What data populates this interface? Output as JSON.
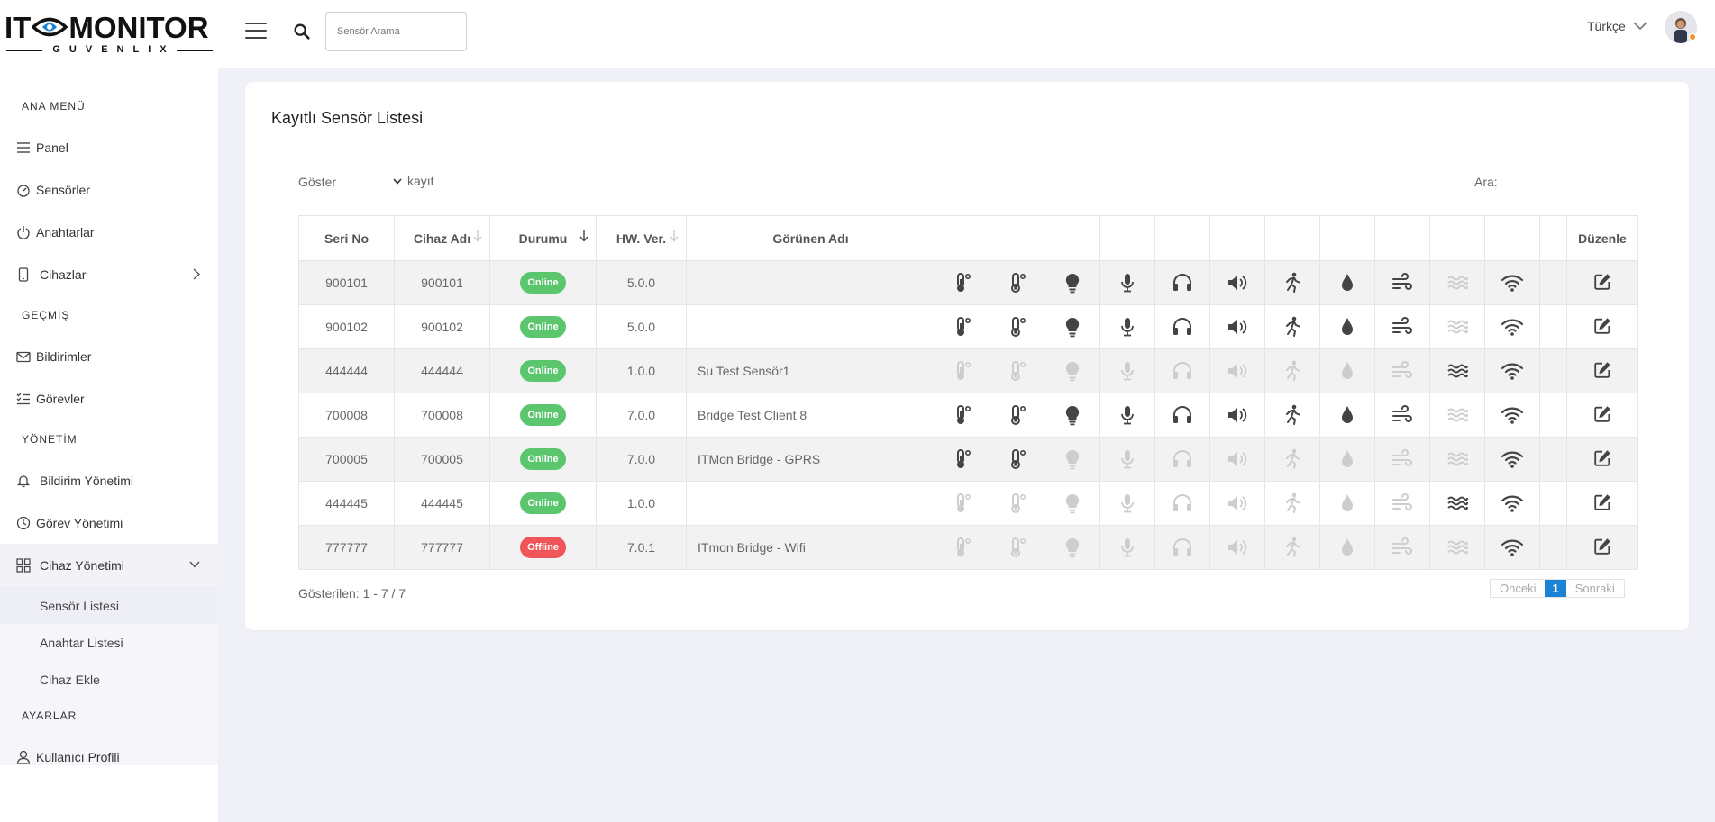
{
  "brand": {
    "logo_main_left": "IT",
    "logo_main_right": "MONITOR",
    "logo_sub": "GUVENLIX"
  },
  "topbar": {
    "search_placeholder": "Sensör Arama",
    "language": "Türkçe"
  },
  "sidebar": {
    "sections": {
      "main": "ANA MENÜ",
      "history": "GEÇMİŞ",
      "management": "YÖNETİM",
      "settings": "AYARLAR"
    },
    "items": {
      "panel": "Panel",
      "sensors": "Sensörler",
      "switches": "Anahtarlar",
      "devices": "Cihazlar",
      "notifications": "Bildirimler",
      "tasks": "Görevler",
      "notification_mgmt": "Bildirim Yönetimi",
      "task_mgmt": "Görev Yönetimi",
      "device_mgmt": "Cihaz Yönetimi",
      "profile": "Kullanıcı Profili"
    },
    "sub_items": {
      "sensor_list": "Sensör Listesi",
      "switch_list": "Anahtar Listesi",
      "add_device": "Cihaz Ekle"
    }
  },
  "main": {
    "title": "Kayıtlı Sensör Listesi",
    "show_label": "Göster",
    "show_suffix": "kayıt",
    "search_label": "Ara:",
    "columns": [
      "Seri No",
      "Cihaz Adı",
      "Durumu",
      "HW. Ver.",
      "Görünen Adı",
      "Düzenle"
    ],
    "sensor_icon_types": [
      "thermometer-icon",
      "thermometer-alt-icon",
      "lightbulb-icon",
      "microphone-icon",
      "headphones-icon",
      "speaker-icon",
      "motion-icon",
      "water-drop-icon",
      "wind-icon",
      "water-level-icon",
      "wifi-icon"
    ],
    "rows": [
      {
        "serial": "900101",
        "device": "900101",
        "status": "Online",
        "hw": "5.0.0",
        "display_name": "",
        "sensors": [
          1,
          1,
          1,
          1,
          1,
          1,
          1,
          1,
          1,
          0,
          1
        ]
      },
      {
        "serial": "900102",
        "device": "900102",
        "status": "Online",
        "hw": "5.0.0",
        "display_name": "",
        "sensors": [
          1,
          1,
          1,
          1,
          1,
          1,
          1,
          1,
          1,
          0,
          1
        ]
      },
      {
        "serial": "444444",
        "device": "444444",
        "status": "Online",
        "hw": "1.0.0",
        "display_name": "Su Test Sensör1",
        "sensors": [
          0,
          0,
          0,
          0,
          0,
          0,
          0,
          0,
          0,
          1,
          1
        ]
      },
      {
        "serial": "700008",
        "device": "700008",
        "status": "Online",
        "hw": "7.0.0",
        "display_name": "Bridge Test Client 8",
        "sensors": [
          1,
          1,
          1,
          1,
          1,
          1,
          1,
          1,
          1,
          0,
          1
        ]
      },
      {
        "serial": "700005",
        "device": "700005",
        "status": "Online",
        "hw": "7.0.0",
        "display_name": "ITMon Bridge - GPRS",
        "sensors": [
          1,
          1,
          0,
          0,
          0,
          0,
          0,
          0,
          0,
          0,
          1
        ]
      },
      {
        "serial": "444445",
        "device": "444445",
        "status": "Online",
        "hw": "1.0.0",
        "display_name": "",
        "sensors": [
          0,
          0,
          0,
          0,
          0,
          0,
          0,
          0,
          0,
          1,
          1
        ]
      },
      {
        "serial": "777777",
        "device": "777777",
        "status": "Offline",
        "hw": "7.0.1",
        "display_name": "ITmon Bridge - Wifi",
        "sensors": [
          0,
          0,
          0,
          0,
          0,
          0,
          0,
          0,
          0,
          0,
          1
        ]
      }
    ],
    "footer_info": "Gösterilen: 1 - 7 / 7",
    "pager": {
      "prev": "Önceki",
      "current": "1",
      "next": "Sonraki"
    }
  },
  "colors": {
    "online": "#5cc66f",
    "offline": "#f0555a",
    "page_active": "#1a83d6",
    "icon_active": "#444444",
    "icon_inactive": "#cdcdcd"
  }
}
